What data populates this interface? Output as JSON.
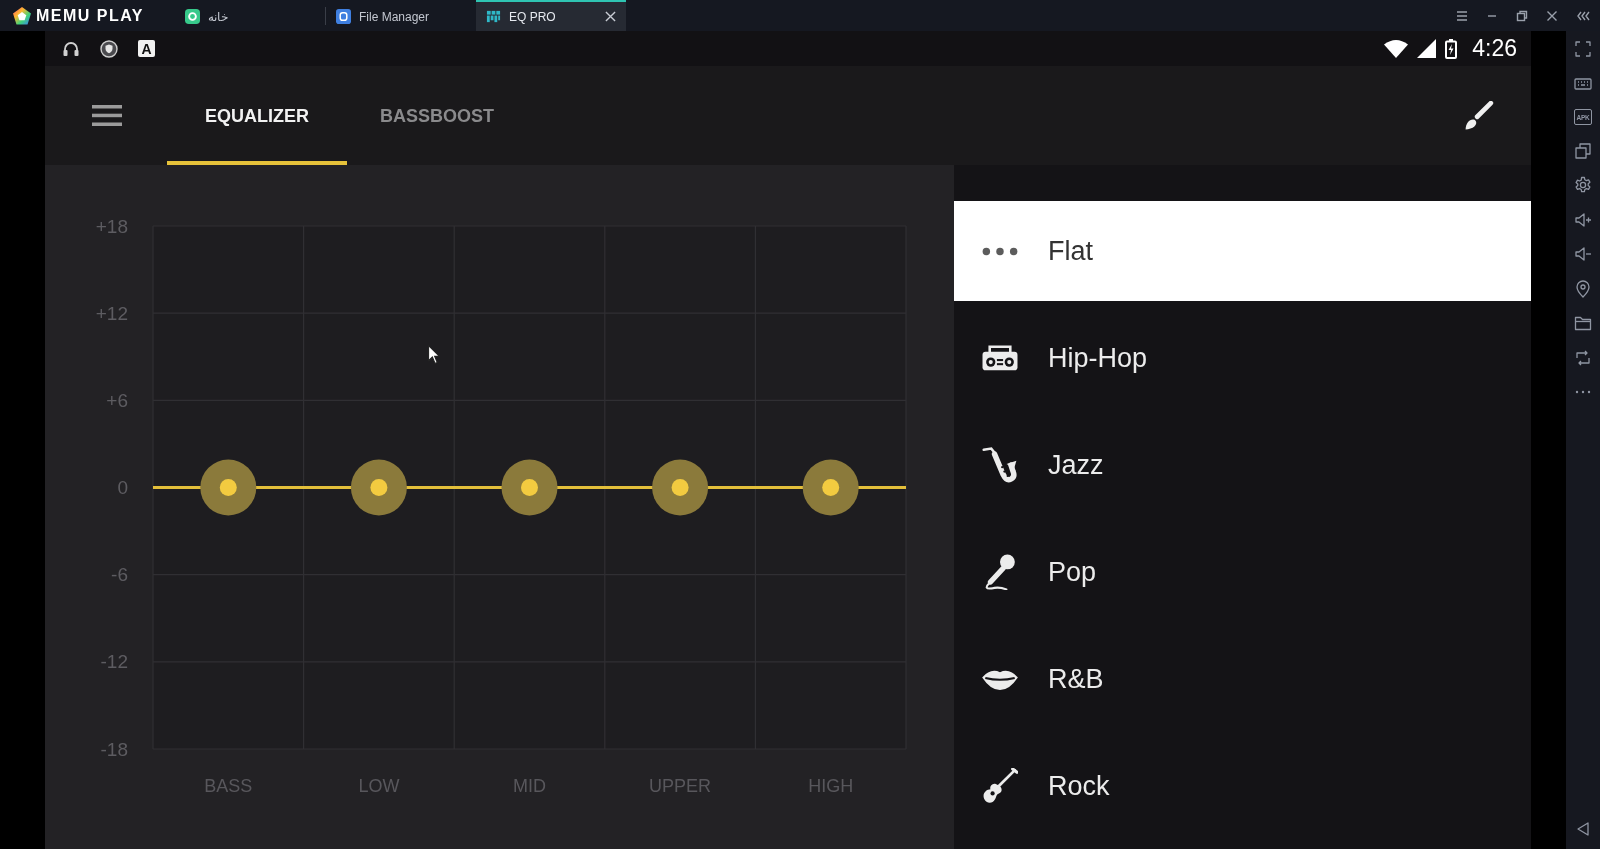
{
  "emulator": {
    "brand": "MEMU PLAY",
    "tabs": [
      {
        "label": "خانه",
        "selected": false
      },
      {
        "label": "File Manager",
        "selected": false
      },
      {
        "label": "EQ PRO",
        "selected": true
      }
    ],
    "sidebar": {
      "apk_label": "APK"
    }
  },
  "status_bar": {
    "notification_letter": "A",
    "time": "4:26"
  },
  "app_bar": {
    "tabs": [
      {
        "label": "EQUALIZER",
        "selected": true
      },
      {
        "label": "BASSBOOST",
        "selected": false
      }
    ]
  },
  "equalizer": {
    "chart_data": {
      "type": "line",
      "categories": [
        "BASS",
        "LOW",
        "MID",
        "UPPER",
        "HIGH"
      ],
      "values": [
        0,
        0,
        0,
        0,
        0
      ],
      "ylim": [
        -18,
        18
      ],
      "yticks": [
        -18,
        -12,
        -6,
        0,
        {
          "value": 6,
          "label": "+6"
        },
        {
          "value": 12,
          "label": "+12"
        },
        {
          "value": 18,
          "label": "+18"
        }
      ],
      "grid": true,
      "marker": "circle"
    }
  },
  "presets": [
    {
      "label": "Flat",
      "selected": true
    },
    {
      "label": "Hip-Hop",
      "selected": false
    },
    {
      "label": "Jazz",
      "selected": false
    },
    {
      "label": "Pop",
      "selected": false
    },
    {
      "label": "R&B",
      "selected": false
    },
    {
      "label": "Rock",
      "selected": false
    }
  ]
}
